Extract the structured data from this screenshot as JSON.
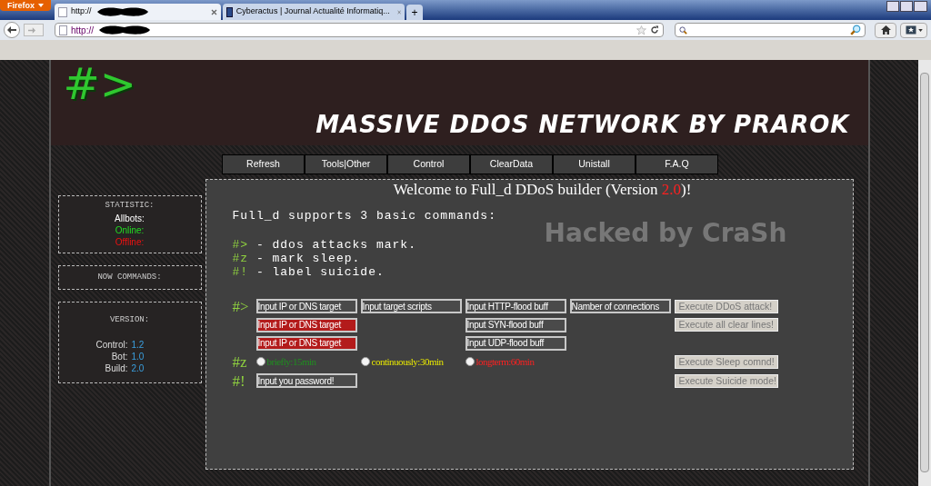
{
  "browser": {
    "firefox_button": "Firefox",
    "tabs": [
      {
        "title": "http://",
        "selected": true,
        "redacted": true
      },
      {
        "title": "Cyberactus | Journal Actualité Informatiq...",
        "selected": false,
        "redacted": false
      }
    ],
    "new_tab": "+",
    "address": {
      "value": "http://",
      "redacted": true
    }
  },
  "header": {
    "logo": "#>",
    "title": "MASSIVE DDOS NETWORK BY PRAROK"
  },
  "menu": [
    "Refresh",
    "Tools|Other",
    "Control",
    "ClearData",
    "Unistall",
    "F.A.Q"
  ],
  "sidebar": {
    "statistic": {
      "title": "STATISTIC:",
      "items": [
        {
          "label": "Allbots:",
          "color": "#ffffff"
        },
        {
          "label": "Online:",
          "color": "#22dd22"
        },
        {
          "label": "Offline:",
          "color": "#ee1111"
        }
      ]
    },
    "commands": {
      "title": "NOW COMMANDS:"
    },
    "version": {
      "title": "VERSION:",
      "items": [
        {
          "label": "Control:",
          "value": "1.2"
        },
        {
          "label": "Bot:",
          "value": "1.0"
        },
        {
          "label": "Build:",
          "value": "2.0"
        }
      ]
    }
  },
  "main": {
    "welcome": {
      "before": "Welcome to Full_d DDoS builder (Version ",
      "version": "2.0",
      "after": ")!"
    },
    "intro": "Full_d supports 3 basic commands:",
    "commands": [
      {
        "marker": "#>",
        "text": " - ddos attacks mark."
      },
      {
        "marker": "#z",
        "text": " - mark sleep."
      },
      {
        "marker": "#!",
        "text": " - label suicide."
      }
    ],
    "overlay": "Hacked by CraSh",
    "form": [
      {
        "kind": "fields",
        "marker": "#>",
        "fields": [
          {
            "kind": "target",
            "value": "Input IP or DNS target",
            "invalid": false
          },
          {
            "kind": "scripts",
            "value": "Input target scripts",
            "invalid": false
          },
          {
            "kind": "flood",
            "value": "Input HTTP-flood buff",
            "invalid": false
          },
          {
            "kind": "connections",
            "value": "Namber of connections",
            "invalid": false
          }
        ],
        "button": "Execute DDoS attack!"
      },
      {
        "kind": "fields",
        "fields": [
          {
            "kind": "target",
            "value": "Input IP or DNS target",
            "invalid": true
          },
          {
            "kind": "flood",
            "value": "Input SYN-flood buff",
            "invalid": false
          }
        ],
        "button": "Execute all clear lines!"
      },
      {
        "kind": "fields",
        "fields": [
          {
            "kind": "target",
            "value": "Input IP or DNS target",
            "invalid": true
          },
          {
            "kind": "flood",
            "value": "Input UDP-flood buff",
            "invalid": false
          }
        ]
      },
      {
        "kind": "radios",
        "marker": "#z",
        "radios": [
          {
            "label": "briefly:15min",
            "color": "#1f8f1f",
            "selected": false
          },
          {
            "label": "continuously:30min",
            "color": "#e8e800",
            "selected": false
          },
          {
            "label": "longterm:60min",
            "color": "#ff2020",
            "selected": false
          }
        ],
        "button": "Execute Sleep comnd!"
      },
      {
        "kind": "fields",
        "marker": "#!",
        "fields": [
          {
            "kind": "target",
            "value": "Input you password!",
            "invalid": false
          }
        ],
        "button": "Execute Suicide mode!"
      }
    ]
  }
}
